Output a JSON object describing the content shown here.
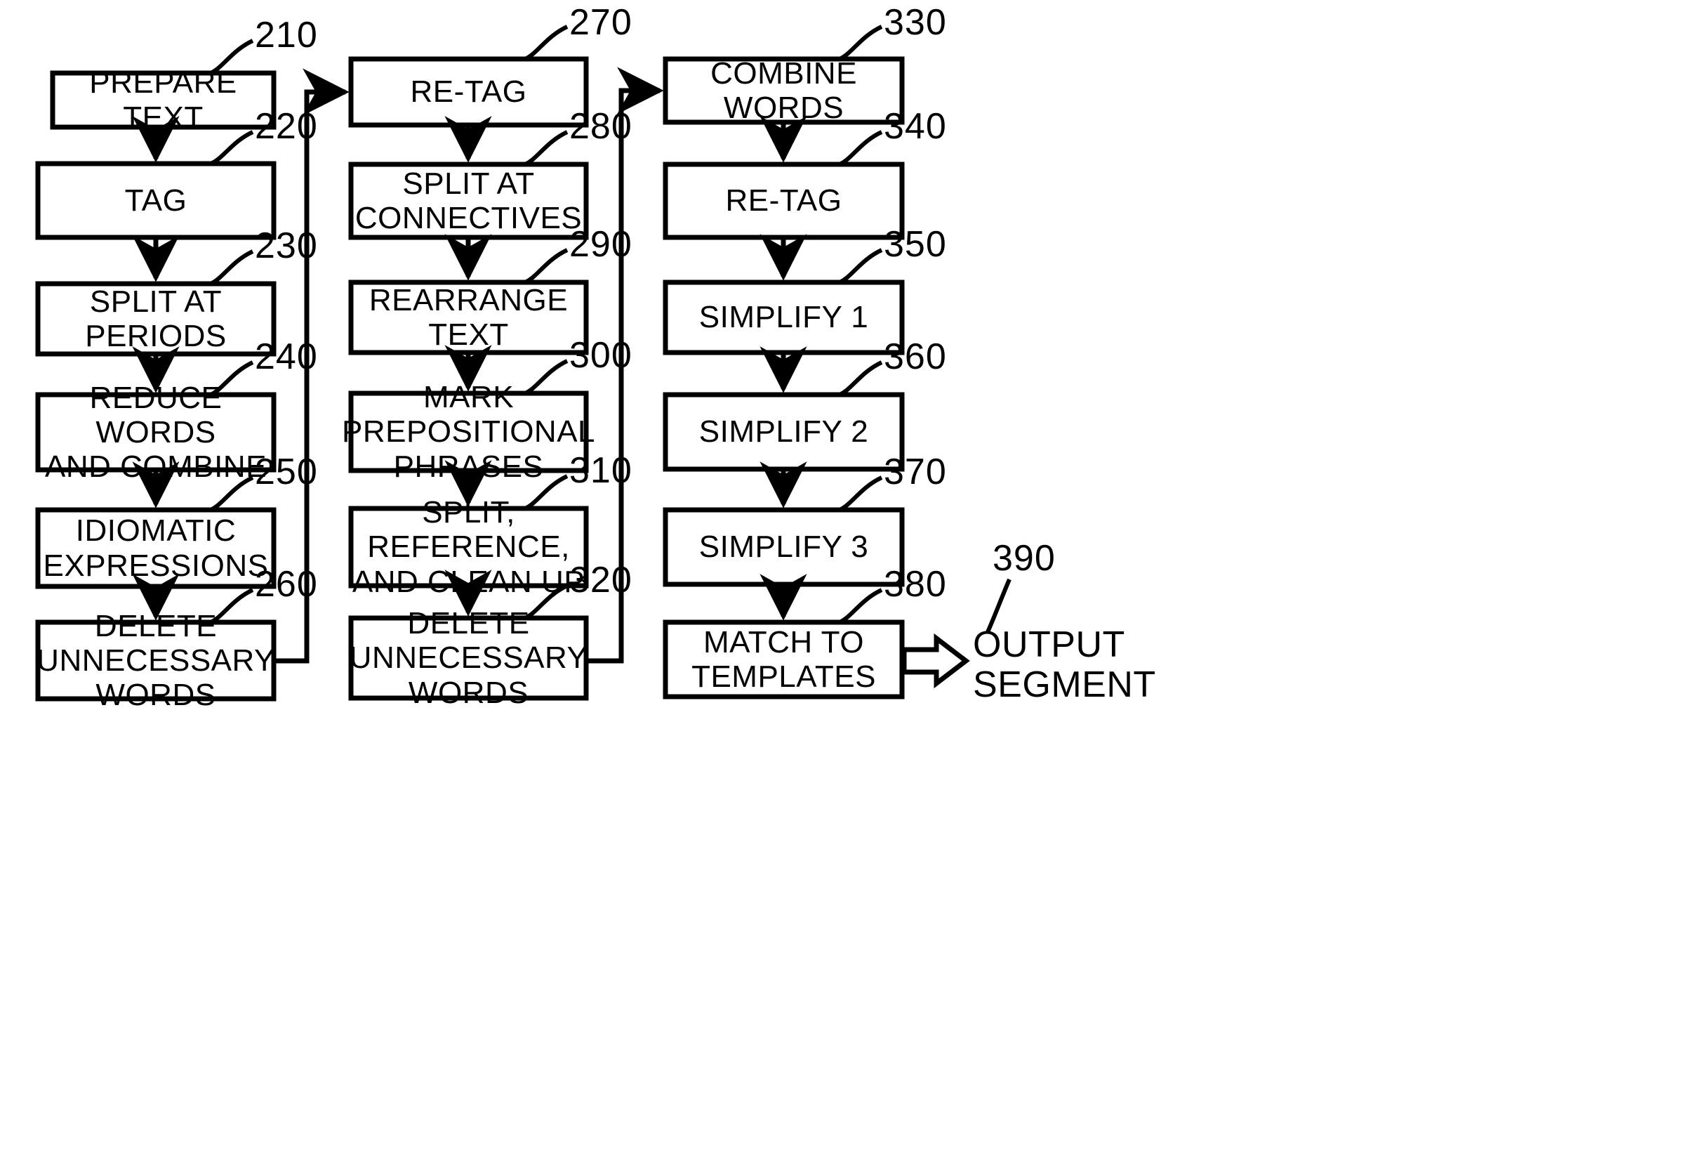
{
  "figure": {
    "type": "patent-flowchart",
    "columns": [
      {
        "id": "column-1",
        "boxes": [
          {
            "ref": "210",
            "label": "PREPARE TEXT"
          },
          {
            "ref": "220",
            "label": "TAG"
          },
          {
            "ref": "230",
            "label": "SPLIT AT PERIODS"
          },
          {
            "ref": "240",
            "label": "REDUCE WORDS\nAND COMBINE"
          },
          {
            "ref": "250",
            "label": "IDIOMATIC\nEXPRESSIONS"
          },
          {
            "ref": "260",
            "label": "DELETE\nUNNECESSARY\nWORDS"
          }
        ]
      },
      {
        "id": "column-2",
        "boxes": [
          {
            "ref": "270",
            "label": "RE-TAG"
          },
          {
            "ref": "280",
            "label": "SPLIT AT\nCONNECTIVES"
          },
          {
            "ref": "290",
            "label": "REARRANGE TEXT"
          },
          {
            "ref": "300",
            "label": "MARK\nPREPOSITIONAL\nPHRASES"
          },
          {
            "ref": "310",
            "label": "SPLIT,\nREFERENCE,\nAND CLEAN UP"
          },
          {
            "ref": "320",
            "label": "DELETE\nUNNECESSARY\nWORDS"
          }
        ]
      },
      {
        "id": "column-3",
        "boxes": [
          {
            "ref": "330",
            "label": "COMBINE WORDS"
          },
          {
            "ref": "340",
            "label": "RE-TAG"
          },
          {
            "ref": "350",
            "label": "SIMPLIFY 1"
          },
          {
            "ref": "360",
            "label": "SIMPLIFY 2"
          },
          {
            "ref": "370",
            "label": "SIMPLIFY 3"
          },
          {
            "ref": "380",
            "label": "MATCH TO\nTEMPLATES"
          }
        ]
      }
    ],
    "output": {
      "ref": "390",
      "label": "OUTPUT\nSEGMENT"
    },
    "colors": {
      "ink": "#000000",
      "paper": "#ffffff"
    }
  }
}
